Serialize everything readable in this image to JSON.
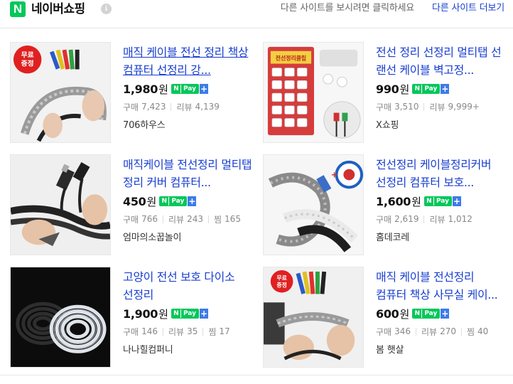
{
  "header": {
    "logo_letter": "N",
    "brand": "네이버쇼핑",
    "info_icon": "i",
    "hint": "다른 사이트를 보시려면 클릭하세요",
    "more_link": "다른 사이트 더보기"
  },
  "labels": {
    "won": "원",
    "purchase": "구매",
    "review": "리뷰",
    "wish": "찜",
    "npay_n": "N",
    "npay_pay": "Pay",
    "npay_plus": "+"
  },
  "products": [
    {
      "title": "매직 케이블 전선 정리 책상 컴퓨터 선정리 강...",
      "price": "1,980",
      "purchase": "7,423",
      "review": "4,139",
      "wish": "",
      "shop": "706하우스",
      "badge": "무료\n증정"
    },
    {
      "title": "전선 정리 선정리 멀티탭 선 랜선 케이블 벽고정...",
      "price": "990",
      "purchase": "3,510",
      "review": "9,999+",
      "wish": "",
      "shop": "X쇼핑",
      "badge": ""
    },
    {
      "title": "매직케이블 전선정리 멀티탭 정리 커버 컴퓨터...",
      "price": "450",
      "purchase": "766",
      "review": "243",
      "wish": "165",
      "shop": "엄마의소꿉놀이",
      "badge": ""
    },
    {
      "title": "전선정리 케이블정리커버 선정리 컴퓨터 보호...",
      "price": "1,600",
      "purchase": "2,619",
      "review": "1,012",
      "wish": "",
      "shop": "홈데코레",
      "badge": ""
    },
    {
      "title": "고양이 전선 보호 다이소 선정리",
      "price": "1,900",
      "purchase": "146",
      "review": "35",
      "wish": "17",
      "shop": "나나힐컴퍼니",
      "badge": ""
    },
    {
      "title": "매직 케이블 전선정리 컴퓨터 책상 사무실 케이...",
      "price": "600",
      "purchase": "346",
      "review": "270",
      "wish": "40",
      "shop": "봄 햇살",
      "badge": "무료\n증정"
    }
  ],
  "colors": {
    "naver_green": "#03c75a",
    "link_blue": "#1a3fd0",
    "plus_blue": "#3d7be8",
    "badge_red": "#e02020"
  }
}
